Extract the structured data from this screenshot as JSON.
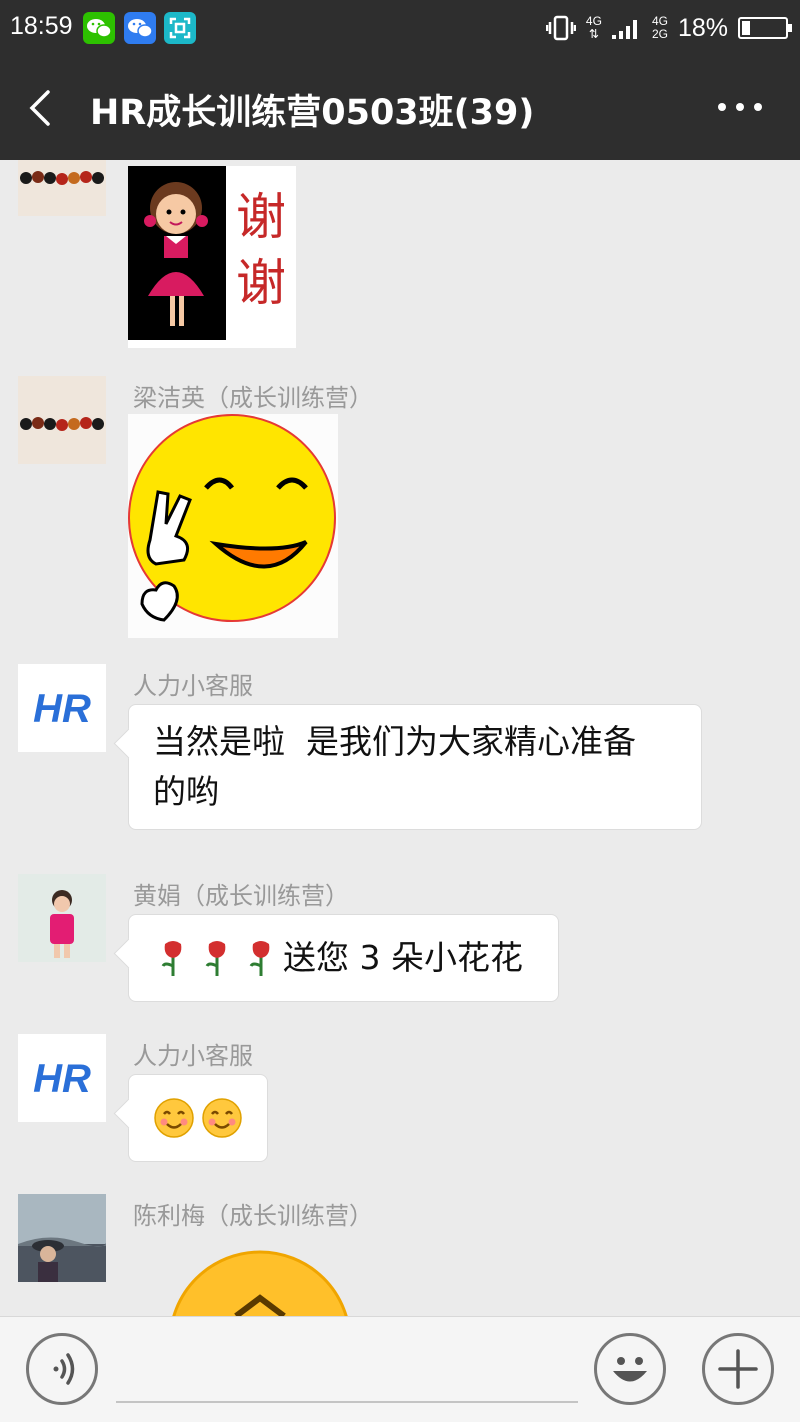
{
  "status_bar": {
    "time": "18:59",
    "network_top": "4G",
    "network_top2": "4G",
    "network_bottom": "2G",
    "battery_percent": "18%",
    "battery_level": 0.18,
    "app_icons": [
      "wechat-icon",
      "moments-icon",
      "scan-icon"
    ]
  },
  "header": {
    "title": "HR成长训练营0503班(39)",
    "back_icon": "chevron-left-icon",
    "more_icon": "more-dots-icon"
  },
  "messages": [
    {
      "sender": "",
      "type": "sticker",
      "sticker": "girl-thanks-sticker",
      "sticker_text": [
        "谢",
        "谢"
      ]
    },
    {
      "sender": "梁洁英（成长训练营）",
      "type": "sticker",
      "sticker": "smiley-peace-sticker"
    },
    {
      "sender": "人力小客服",
      "type": "text",
      "lines": [
        "当然是啦  是我们为大家精心准备",
        "的哟"
      ]
    },
    {
      "sender": "黄娟（成长训练营）",
      "type": "text",
      "prefix_icons": [
        "rose-icon",
        "rose-icon",
        "rose-icon"
      ],
      "text": "送您 3 朵小花花"
    },
    {
      "sender": "人力小客服",
      "type": "text",
      "emoji": [
        "blush-emoji",
        "blush-emoji"
      ]
    },
    {
      "sender": "陈利梅（成长训练营）",
      "type": "sticker",
      "sticker": "yellow-face-sticker"
    }
  ],
  "hr_logo_text": "HR",
  "input_bar": {
    "voice_icon": "voice-icon",
    "emoji_icon": "emoji-icon",
    "plus_icon": "plus-icon"
  },
  "colors": {
    "header_bg": "#2e2e2e",
    "chat_bg": "#ebebeb",
    "bubble_bg": "#ffffff",
    "hr_blue": "#2a6fd8"
  }
}
